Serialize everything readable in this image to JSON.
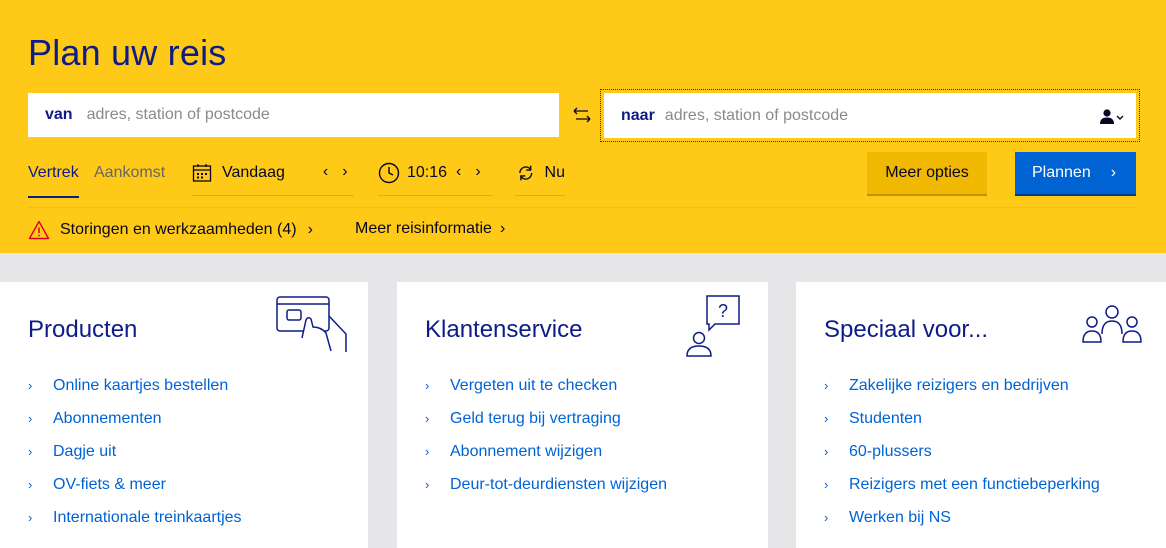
{
  "planner": {
    "title": "Plan uw reis",
    "from": {
      "label": "van",
      "placeholder": "adres, station of postcode"
    },
    "to": {
      "label": "naar",
      "placeholder": "adres, station of postcode"
    },
    "tabs": [
      "Vertrek",
      "Aankomst"
    ],
    "date": "Vandaag",
    "time": "10:16",
    "now": "Nu",
    "more_options": "Meer opties",
    "plan_button": "Plannen",
    "disruptions": "Storingen en werkzaamheden (4)",
    "more_info": "Meer reisinformatie"
  },
  "cards": [
    {
      "title": "Producten",
      "links": [
        "Online kaartjes bestellen",
        "Abonnementen",
        "Dagje uit",
        "OV-fiets & meer",
        "Internationale treinkaartjes"
      ]
    },
    {
      "title": "Klantenservice",
      "links": [
        "Vergeten uit te checken",
        "Geld terug bij vertraging",
        "Abonnement wijzigen",
        "Deur-tot-deurdiensten wijzigen"
      ]
    },
    {
      "title": "Speciaal voor...",
      "links": [
        "Zakelijke reizigers en bedrijven",
        "Studenten",
        "60-plussers",
        "Reizigers met een functiebeperking",
        "Werken bij NS"
      ]
    }
  ],
  "colors": {
    "yellow": "#ffc917",
    "navy": "#0d1c86",
    "blue": "#0063d3",
    "warning": "#db0029"
  },
  "icons": [
    "swap-icon",
    "traveller-icon",
    "calendar-icon",
    "clock-icon",
    "refresh-icon",
    "warning-icon",
    "card-hand-icon",
    "question-person-icon",
    "group-icon"
  ]
}
